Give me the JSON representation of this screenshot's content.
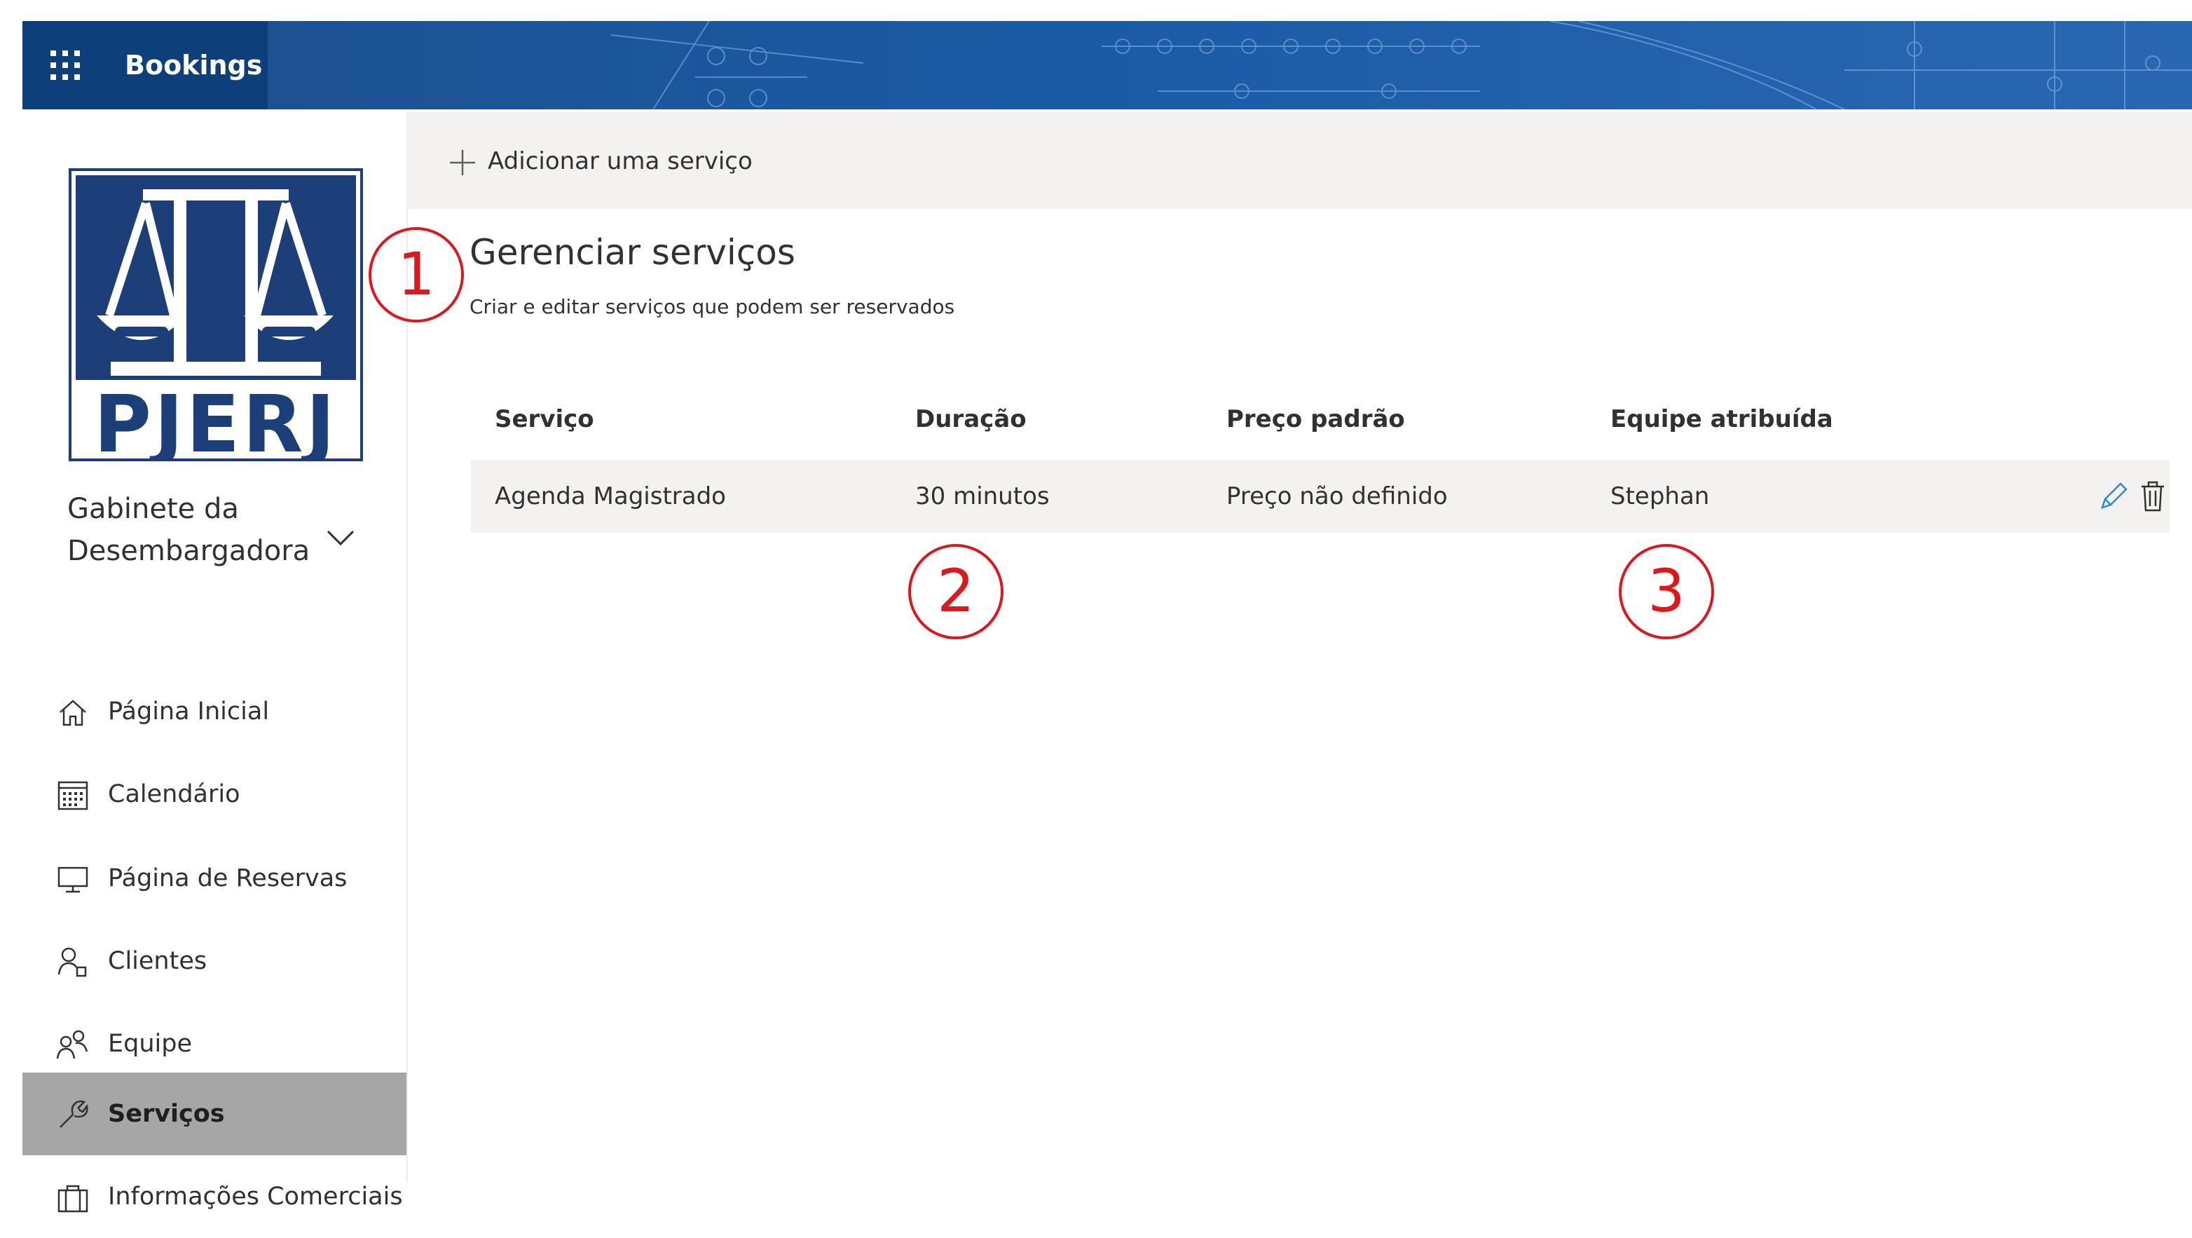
{
  "app": {
    "name": "Bookings",
    "launcher_icon": "waffle-icon",
    "header_color": "#0d3f7a"
  },
  "business": {
    "logo_text": "PJERJ",
    "name": "Gabinete da Desembargadora"
  },
  "sidebar": {
    "items": [
      {
        "label": "Página Inicial",
        "icon": "home-icon",
        "active": false
      },
      {
        "label": "Calendário",
        "icon": "calendar-icon",
        "active": false
      },
      {
        "label": "Página de Reservas",
        "icon": "monitor-icon",
        "active": false
      },
      {
        "label": "Clientes",
        "icon": "customer-icon",
        "active": false
      },
      {
        "label": "Equipe",
        "icon": "people-icon",
        "active": false
      },
      {
        "label": "Serviços",
        "icon": "wrench-icon",
        "active": true
      },
      {
        "label": "Informações Comerciais",
        "icon": "briefcase-icon",
        "active": false
      }
    ]
  },
  "toolbar": {
    "add_label": "Adicionar uma serviço"
  },
  "main": {
    "title": "Gerenciar serviços",
    "subtitle": "Criar e editar serviços que podem ser reservados"
  },
  "table": {
    "headers": [
      "Serviço",
      "Duração",
      "Preço padrão",
      "Equipe atribuída"
    ],
    "rows": [
      [
        "Agenda Magistrado",
        "30 minutos",
        "Preço não definido",
        "Stephan"
      ]
    ],
    "row_actions": [
      "edit-icon",
      "delete-icon"
    ]
  },
  "annotations": [
    "1",
    "2",
    "3"
  ],
  "colors": {
    "annotation": "#e0161d",
    "active_nav": "#a6a6a6",
    "command_bar": "#f3f2f1",
    "edit_icon": "#2b88d8"
  }
}
